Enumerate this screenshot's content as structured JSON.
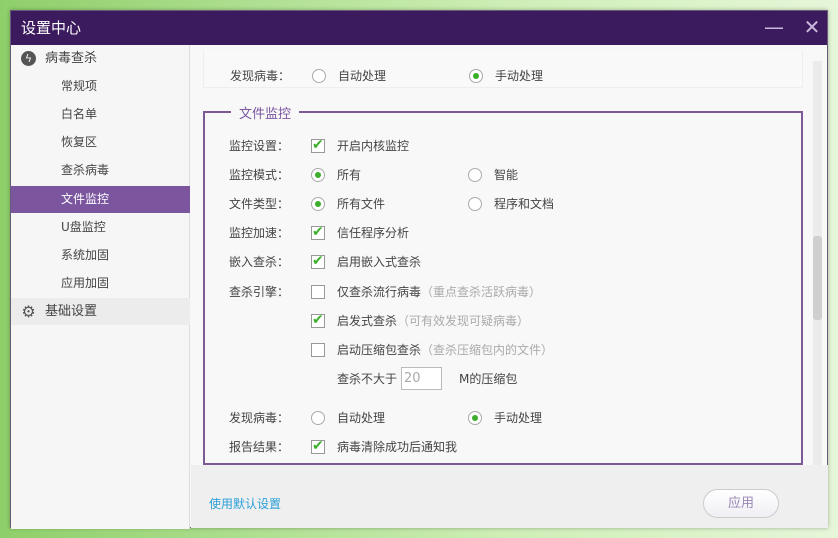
{
  "window": {
    "title": "设置中心",
    "minimize": "—",
    "close": "✕"
  },
  "sidebar": {
    "group1": {
      "label": "病毒查杀",
      "icon": "bolt-icon"
    },
    "items": [
      {
        "label": "常规项"
      },
      {
        "label": "白名单"
      },
      {
        "label": "恢复区"
      },
      {
        "label": "查杀病毒"
      },
      {
        "label": "文件监控"
      },
      {
        "label": "U盘监控"
      },
      {
        "label": "系统加固"
      },
      {
        "label": "应用加固"
      }
    ],
    "group2": {
      "label": "基础设置",
      "icon": "gear-icon"
    }
  },
  "top": {
    "label": "发现病毒：",
    "opt1": "自动处理",
    "opt2": "手动处理"
  },
  "file_monitor": {
    "legend": "文件监控",
    "monitor_setting": {
      "label": "监控设置：",
      "opt": "开启内核监控"
    },
    "monitor_mode": {
      "label": "监控模式：",
      "opt1": "所有",
      "opt2": "智能"
    },
    "file_type": {
      "label": "文件类型：",
      "opt1": "所有文件",
      "opt2": "程序和文档"
    },
    "accel": {
      "label": "监控加速：",
      "opt": "信任程序分析"
    },
    "embed": {
      "label": "嵌入查杀：",
      "opt": "启用嵌入式查杀"
    },
    "engine": {
      "label": "查杀引擎：",
      "opt1": "仅查杀流行病毒",
      "hint1": "（重点查杀活跃病毒）",
      "opt2": "启发式查杀",
      "hint2": "（可有效发现可疑病毒）",
      "opt3": "启动压缩包查杀",
      "hint3": "（查杀压缩包内的文件）",
      "size_prefix": "查杀不大于",
      "size_value": "20",
      "size_suffix": "M的压缩包"
    },
    "found": {
      "label": "发现病毒：",
      "opt1": "自动处理",
      "opt2": "手动处理"
    },
    "report": {
      "label": "报告结果：",
      "opt": "病毒清除成功后通知我"
    }
  },
  "footer": {
    "default_link": "使用默认设置",
    "apply": "应用"
  },
  "colors": {
    "titlebar": "#3b1a5e",
    "accent": "#7b569f",
    "check": "#3bae2a",
    "link": "#2aa0d8"
  }
}
